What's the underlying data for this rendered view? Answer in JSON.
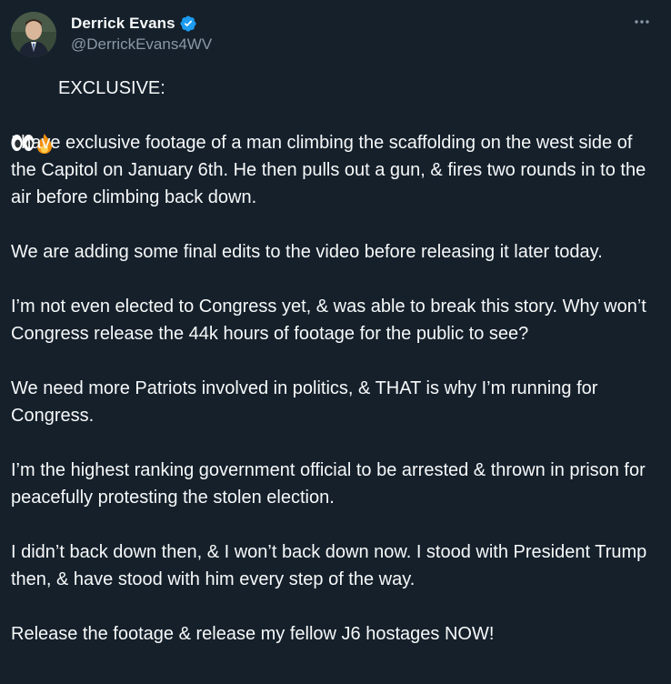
{
  "author": {
    "display_name": "Derrick Evans",
    "handle": "@DerrickEvans4WV",
    "verified": true
  },
  "icons": {
    "verified": "verified-badge-icon",
    "more": "more-options-icon",
    "emoji": [
      "eyes-emoji-icon",
      "fire-emoji-icon"
    ]
  },
  "colors": {
    "background": "#15202b",
    "text": "#f7f9f9",
    "secondary_text": "#8b98a5",
    "verified_blue": "#1d9bf0"
  },
  "tweet": {
    "header": "EXCLUSIVE:",
    "paragraphs": [
      "I have exclusive footage of a man climbing the scaffolding on the west side of the Capitol on January 6th. He then pulls out a gun, & fires two rounds in to the air before climbing back down.",
      "We are adding some final edits to the video before releasing it later today.",
      "I’m not even elected to Congress yet, & was able to break this story. Why won’t Congress release the 44k hours of footage for the public to see?",
      "We need more Patriots involved in politics, & THAT is why I’m running for Congress.",
      "I’m the highest ranking government official to be arrested & thrown in prison for peacefully protesting the stolen election.",
      "I didn’t back down then, & I won’t back down now. I stood with President Trump then, & have stood with him every step of the way.",
      "Release the footage & release my fellow J6 hostages NOW!"
    ]
  }
}
